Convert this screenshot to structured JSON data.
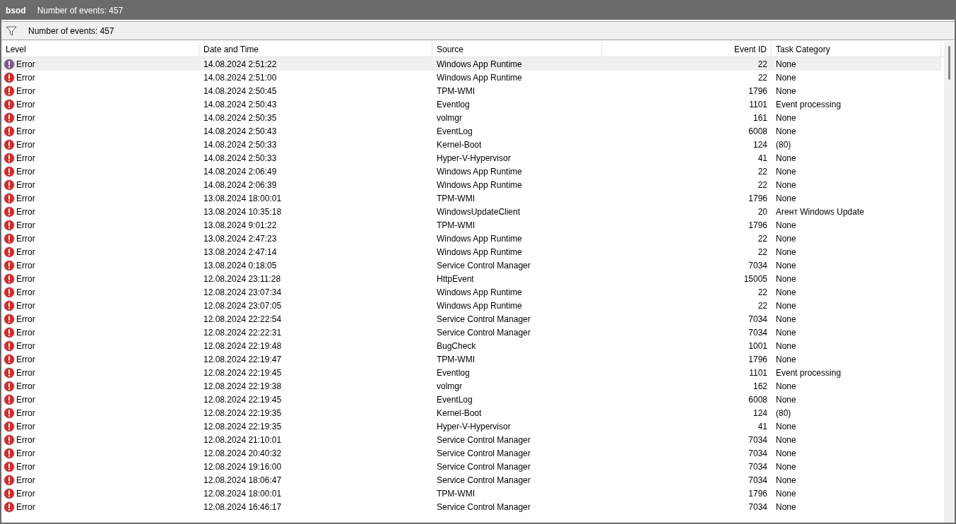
{
  "title_bar": {
    "name": "bsod",
    "count": "Number of events: 457"
  },
  "toolbar": {
    "count": "Number of events: 457"
  },
  "table": {
    "columns": [
      "Level",
      "Date and Time",
      "Source",
      "Event ID",
      "Task Category"
    ],
    "rows": [
      {
        "level": "Error",
        "date": "14.08.2024 2:51:22",
        "source": "Windows App Runtime",
        "event_id": "22",
        "category": "None",
        "selected": true
      },
      {
        "level": "Error",
        "date": "14.08.2024 2:51:00",
        "source": "Windows App Runtime",
        "event_id": "22",
        "category": "None",
        "selected": false
      },
      {
        "level": "Error",
        "date": "14.08.2024 2:50:45",
        "source": "TPM-WMI",
        "event_id": "1796",
        "category": "None",
        "selected": false
      },
      {
        "level": "Error",
        "date": "14.08.2024 2:50:43",
        "source": "Eventlog",
        "event_id": "1101",
        "category": "Event processing",
        "selected": false
      },
      {
        "level": "Error",
        "date": "14.08.2024 2:50:35",
        "source": "volmgr",
        "event_id": "161",
        "category": "None",
        "selected": false
      },
      {
        "level": "Error",
        "date": "14.08.2024 2:50:43",
        "source": "EventLog",
        "event_id": "6008",
        "category": "None",
        "selected": false
      },
      {
        "level": "Error",
        "date": "14.08.2024 2:50:33",
        "source": "Kernel-Boot",
        "event_id": "124",
        "category": "(80)",
        "selected": false
      },
      {
        "level": "Error",
        "date": "14.08.2024 2:50:33",
        "source": "Hyper-V-Hypervisor",
        "event_id": "41",
        "category": "None",
        "selected": false
      },
      {
        "level": "Error",
        "date": "14.08.2024 2:06:49",
        "source": "Windows App Runtime",
        "event_id": "22",
        "category": "None",
        "selected": false
      },
      {
        "level": "Error",
        "date": "14.08.2024 2:06:39",
        "source": "Windows App Runtime",
        "event_id": "22",
        "category": "None",
        "selected": false
      },
      {
        "level": "Error",
        "date": "13.08.2024 18:00:01",
        "source": "TPM-WMI",
        "event_id": "1796",
        "category": "None",
        "selected": false
      },
      {
        "level": "Error",
        "date": "13.08.2024 10:35:18",
        "source": "WindowsUpdateClient",
        "event_id": "20",
        "category": "Агент Windows Update",
        "selected": false
      },
      {
        "level": "Error",
        "date": "13.08.2024 9:01:22",
        "source": "TPM-WMI",
        "event_id": "1796",
        "category": "None",
        "selected": false
      },
      {
        "level": "Error",
        "date": "13.08.2024 2:47:23",
        "source": "Windows App Runtime",
        "event_id": "22",
        "category": "None",
        "selected": false
      },
      {
        "level": "Error",
        "date": "13.08.2024 2:47:14",
        "source": "Windows App Runtime",
        "event_id": "22",
        "category": "None",
        "selected": false
      },
      {
        "level": "Error",
        "date": "13.08.2024 0:18:05",
        "source": "Service Control Manager",
        "event_id": "7034",
        "category": "None",
        "selected": false
      },
      {
        "level": "Error",
        "date": "12.08.2024 23:11:28",
        "source": "HttpEvent",
        "event_id": "15005",
        "category": "None",
        "selected": false
      },
      {
        "level": "Error",
        "date": "12.08.2024 23:07:34",
        "source": "Windows App Runtime",
        "event_id": "22",
        "category": "None",
        "selected": false
      },
      {
        "level": "Error",
        "date": "12.08.2024 23:07:05",
        "source": "Windows App Runtime",
        "event_id": "22",
        "category": "None",
        "selected": false
      },
      {
        "level": "Error",
        "date": "12.08.2024 22:22:54",
        "source": "Service Control Manager",
        "event_id": "7034",
        "category": "None",
        "selected": false
      },
      {
        "level": "Error",
        "date": "12.08.2024 22:22:31",
        "source": "Service Control Manager",
        "event_id": "7034",
        "category": "None",
        "selected": false
      },
      {
        "level": "Error",
        "date": "12.08.2024 22:19:48",
        "source": "BugCheck",
        "event_id": "1001",
        "category": "None",
        "selected": false
      },
      {
        "level": "Error",
        "date": "12.08.2024 22:19:47",
        "source": "TPM-WMI",
        "event_id": "1796",
        "category": "None",
        "selected": false
      },
      {
        "level": "Error",
        "date": "12.08.2024 22:19:45",
        "source": "Eventlog",
        "event_id": "1101",
        "category": "Event processing",
        "selected": false
      },
      {
        "level": "Error",
        "date": "12.08.2024 22:19:38",
        "source": "volmgr",
        "event_id": "162",
        "category": "None",
        "selected": false
      },
      {
        "level": "Error",
        "date": "12.08.2024 22:19:45",
        "source": "EventLog",
        "event_id": "6008",
        "category": "None",
        "selected": false
      },
      {
        "level": "Error",
        "date": "12.08.2024 22:19:35",
        "source": "Kernel-Boot",
        "event_id": "124",
        "category": "(80)",
        "selected": false
      },
      {
        "level": "Error",
        "date": "12.08.2024 22:19:35",
        "source": "Hyper-V-Hypervisor",
        "event_id": "41",
        "category": "None",
        "selected": false
      },
      {
        "level": "Error",
        "date": "12.08.2024 21:10:01",
        "source": "Service Control Manager",
        "event_id": "7034",
        "category": "None",
        "selected": false
      },
      {
        "level": "Error",
        "date": "12.08.2024 20:40:32",
        "source": "Service Control Manager",
        "event_id": "7034",
        "category": "None",
        "selected": false
      },
      {
        "level": "Error",
        "date": "12.08.2024 19:16:00",
        "source": "Service Control Manager",
        "event_id": "7034",
        "category": "None",
        "selected": false
      },
      {
        "level": "Error",
        "date": "12.08.2024 18:06:47",
        "source": "Service Control Manager",
        "event_id": "7034",
        "category": "None",
        "selected": false
      },
      {
        "level": "Error",
        "date": "12.08.2024 18:00:01",
        "source": "TPM-WMI",
        "event_id": "1796",
        "category": "None",
        "selected": false
      },
      {
        "level": "Error",
        "date": "12.08.2024 16:46:17",
        "source": "Service Control Manager",
        "event_id": "7034",
        "category": "None",
        "selected": false
      }
    ]
  }
}
